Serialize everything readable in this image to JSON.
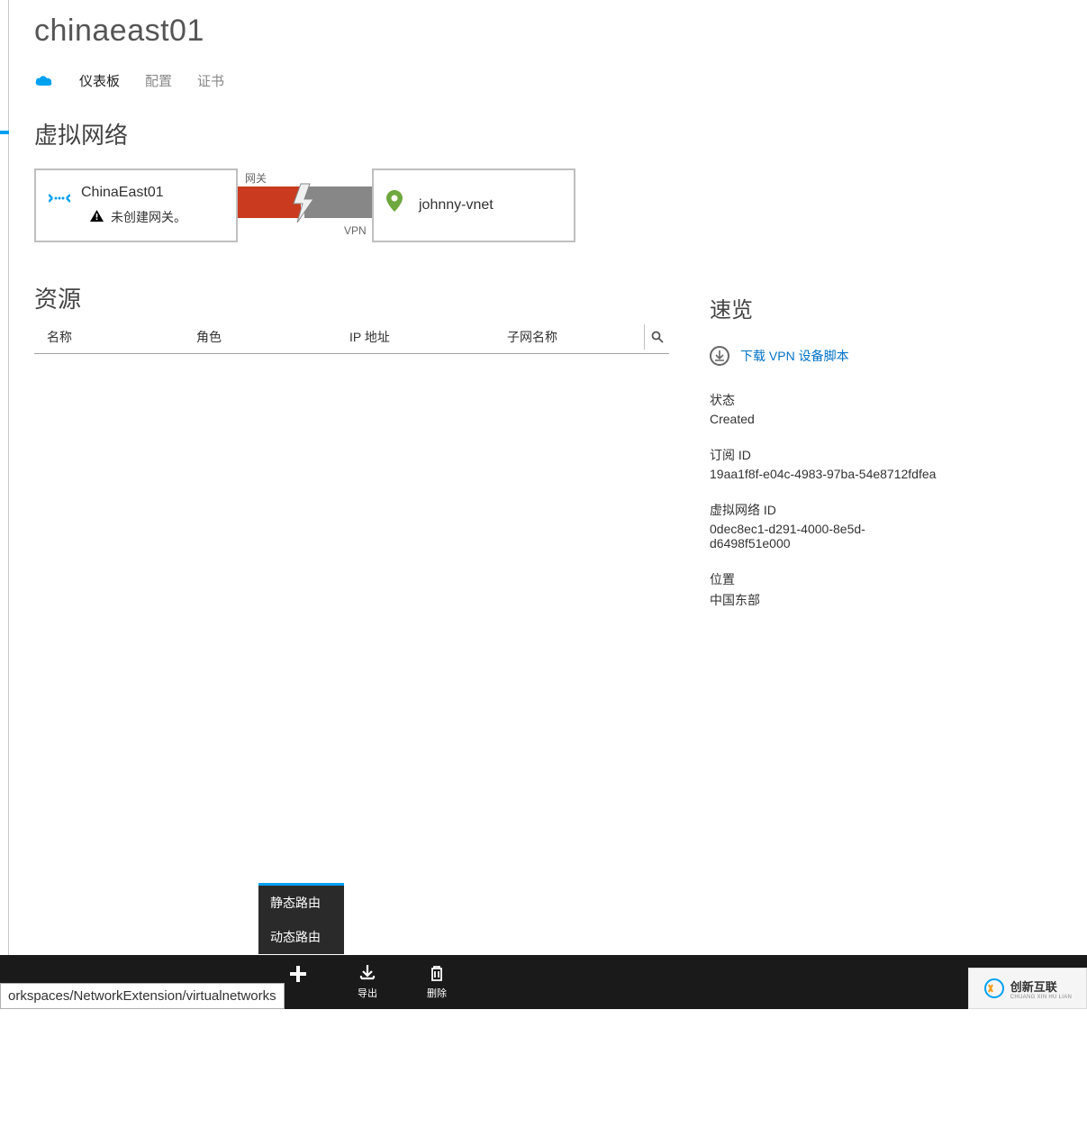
{
  "title": "chinaeast01",
  "tabs": {
    "dashboard": "仪表板",
    "configure": "配置",
    "certificates": "证书"
  },
  "sections": {
    "virtual_network": "虚拟网络",
    "resources": "资源",
    "overview": "速览"
  },
  "diagram": {
    "left_net": "ChinaEast01",
    "warning": "未创建网关。",
    "gateway_label": "网关",
    "vpn_label": "VPN",
    "right_net": "johnny-vnet"
  },
  "table_headers": {
    "name": "名称",
    "role": "角色",
    "ip": "IP 地址",
    "subnet": "子网名称"
  },
  "overview": {
    "download_link": "下载 VPN 设备脚本",
    "status_label": "状态",
    "status_value": "Created",
    "sub_id_label": "订阅 ID",
    "sub_id_value": "19aa1f8f-e04c-4983-97ba-54e8712fdfea",
    "vnet_id_label": "虚拟网络 ID",
    "vnet_id_value": "0dec8ec1-d291-4000-8e5d-d6498f51e000",
    "location_label": "位置",
    "location_value": "中国东部"
  },
  "popup": {
    "static": "静态路由",
    "dynamic": "动态路由"
  },
  "bottom_actions": {
    "add": "",
    "export": "导出",
    "delete": "删除"
  },
  "breadcrumb": "orkspaces/NetworkExtension/virtualnetworks",
  "logo": {
    "text": "创新互联",
    "sub": "CHUANG XIN HU LIAN"
  }
}
